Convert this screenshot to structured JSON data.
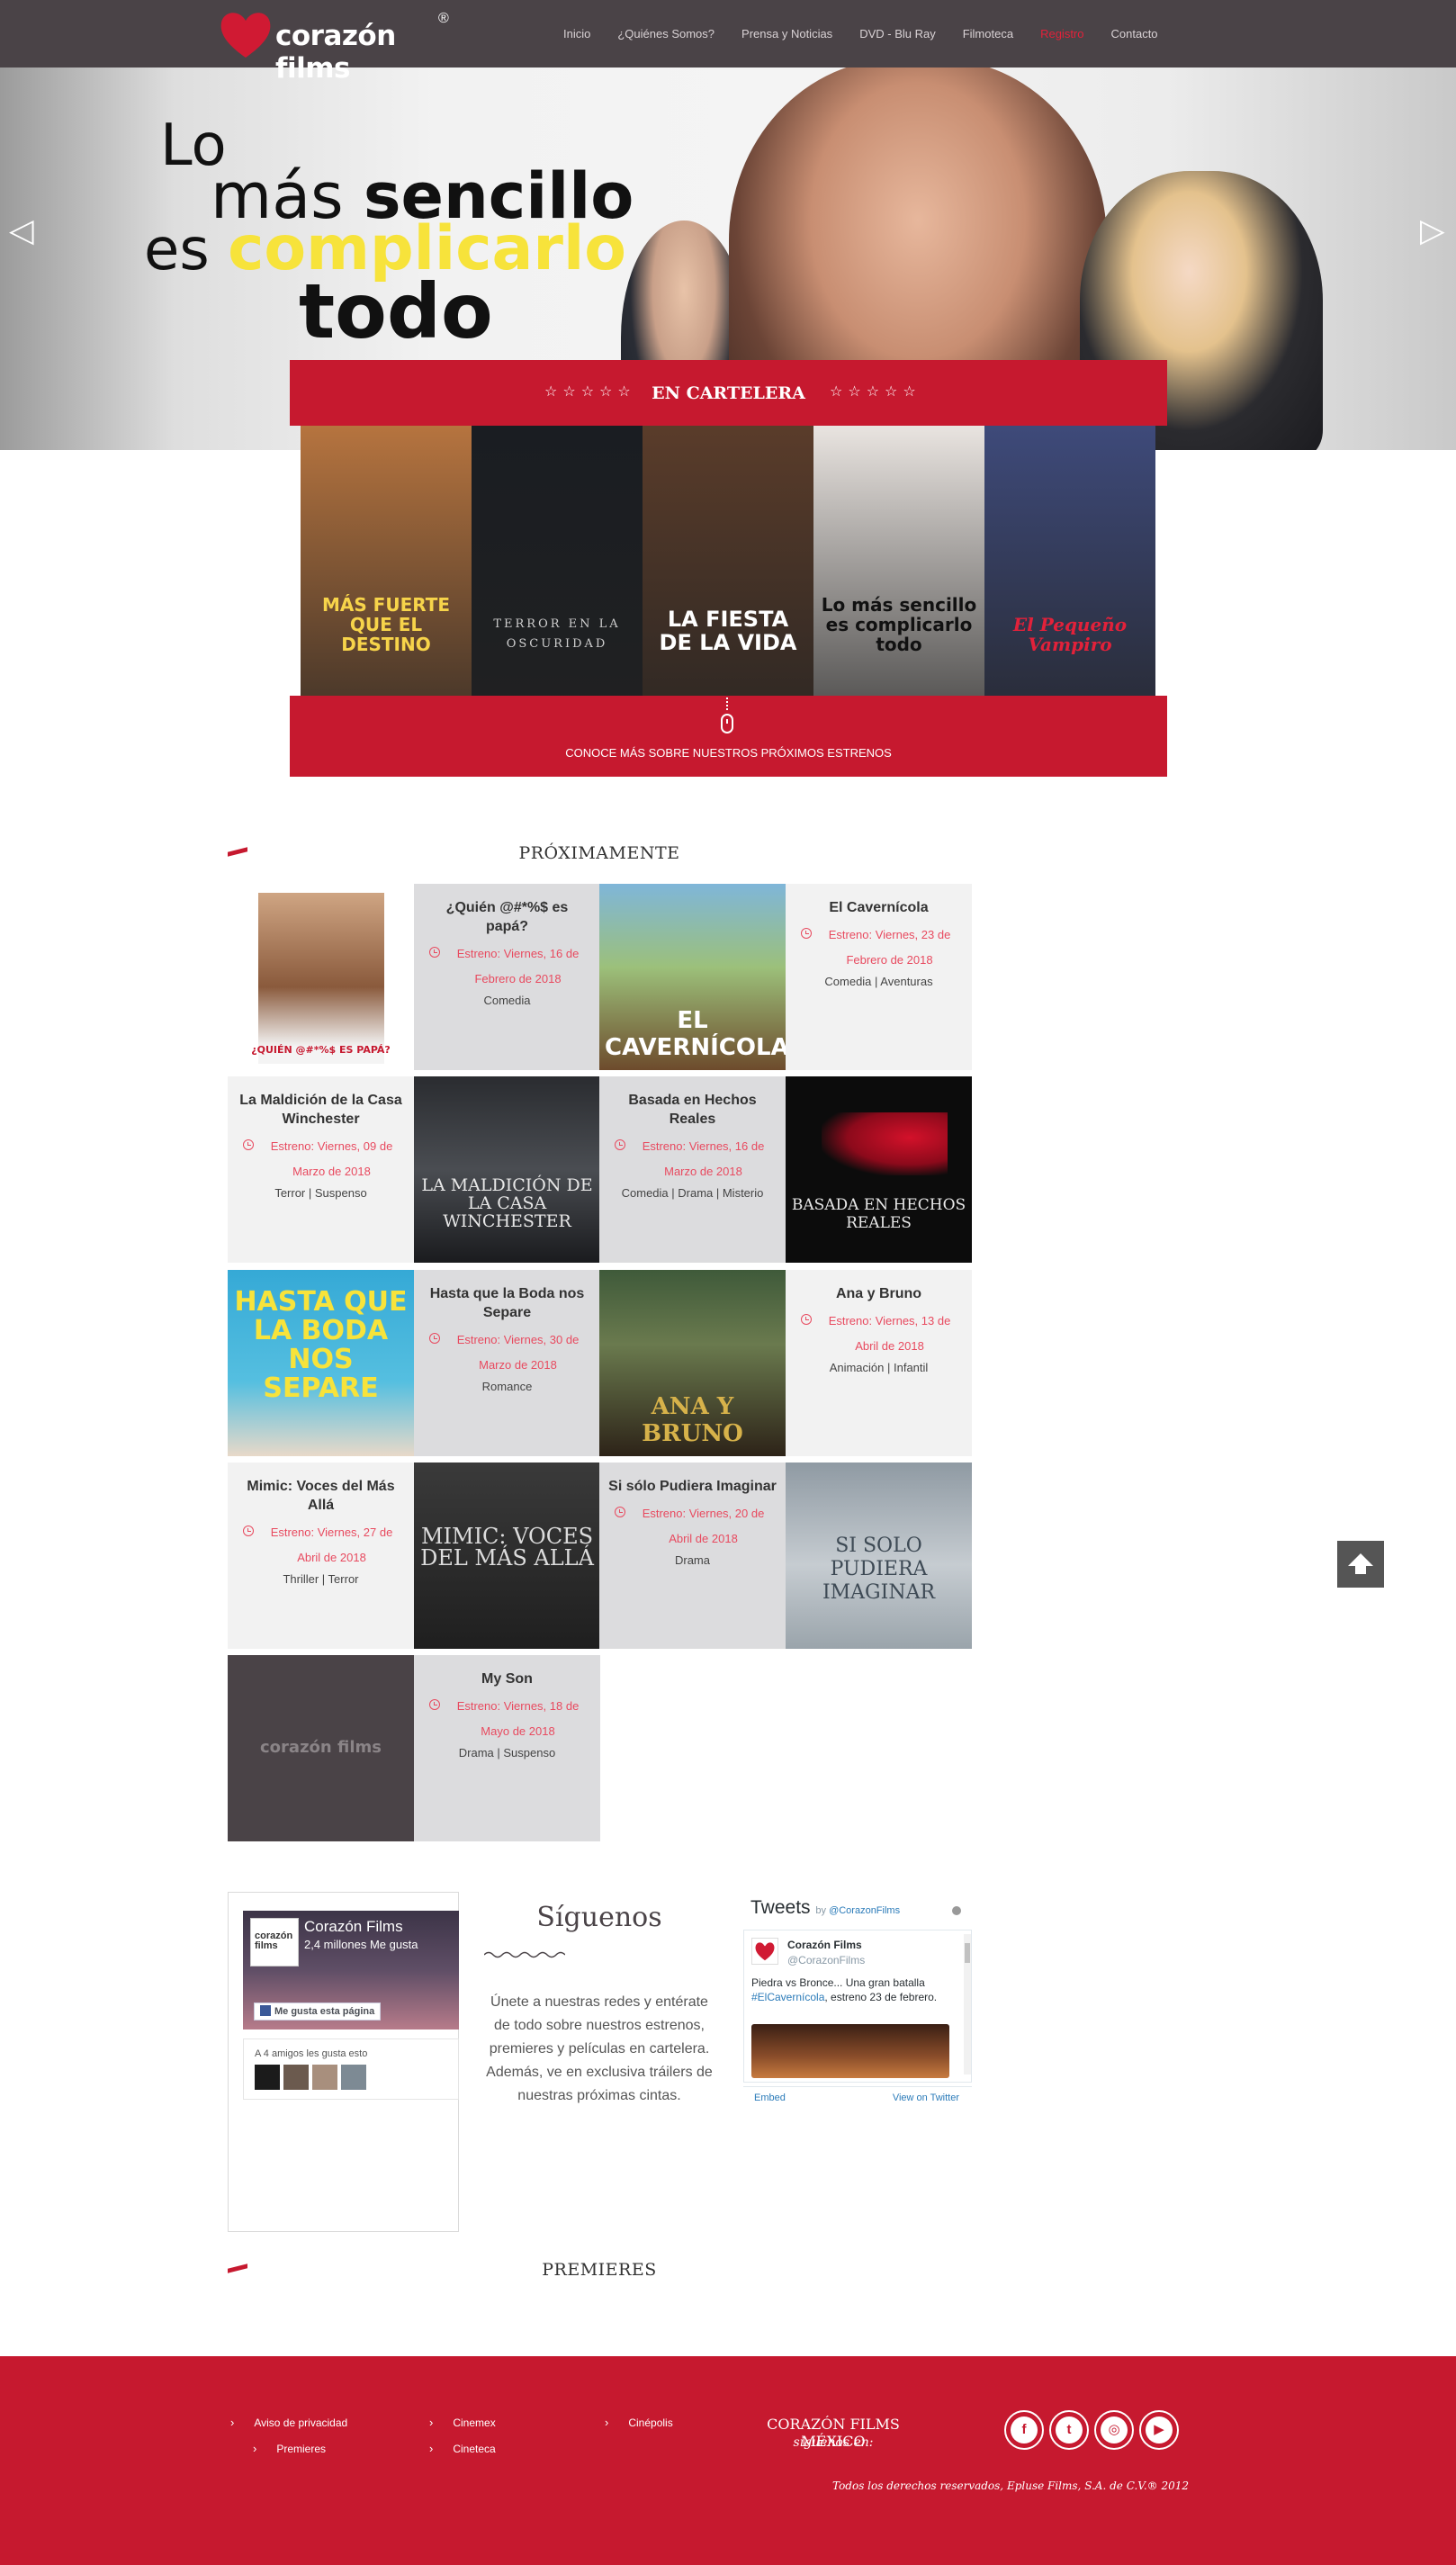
{
  "brand": {
    "name": "corazón films",
    "reg": "®"
  },
  "nav": {
    "items": [
      {
        "label": "Inicio",
        "active": false
      },
      {
        "label": "¿Quiénes Somos?",
        "active": false
      },
      {
        "label": "Prensa y Noticias",
        "active": false
      },
      {
        "label": "DVD - Blu Ray",
        "active": false
      },
      {
        "label": "Filmoteca",
        "active": false
      },
      {
        "label": "Registro",
        "active": true
      },
      {
        "label": "Contacto",
        "active": false
      }
    ]
  },
  "hero": {
    "line1": "Lo",
    "line2_a": "más ",
    "line2_b": "sencillo",
    "line3_a": "es ",
    "line3_b": "complicarlo",
    "line4": "todo",
    "prev_icon": "triangle-left-icon",
    "next_icon": "triangle-right-icon"
  },
  "cartelera": {
    "title": "EN CARTELERA",
    "stars": "☆☆☆☆☆",
    "posters": [
      {
        "title": "MÁS FUERTE QUE EL DESTINO",
        "bg": "#b6743f",
        "color": "#f7d44a"
      },
      {
        "title": "TERROR EN LA OSCURIDAD",
        "bg": "#1a1d22",
        "color": "#cfcfcf"
      },
      {
        "title": "LA FIESTA DE LA VIDA",
        "bg": "#5a3c2a",
        "color": "#ffffff"
      },
      {
        "title": "Lo más sencillo es complicarlo todo",
        "bg": "#e9e4e0",
        "color": "#111111"
      },
      {
        "title": "El Pequeño Vampiro",
        "bg": "#3e4a7a",
        "color": "#e2213a"
      }
    ],
    "more_label": "CONOCE MÁS SOBRE NUESTROS PRÓXIMOS ESTRENOS"
  },
  "proximamente": {
    "title": "PRÓXIMAMENTE",
    "movies": [
      {
        "title": "¿Quién @#*%$ es papá?",
        "release": "Estreno: Viernes, 16 de Febrero de 2018",
        "genre": "Comedia",
        "poster_text": "¿QUIÉN @#*%$ ES PAPÁ?"
      },
      {
        "title": "El Cavernícola",
        "release": "Estreno: Viernes, 23 de Febrero de 2018",
        "genre": "Comedia | Aventuras",
        "poster_text": "EL CAVERNÍCOLA"
      },
      {
        "title": "La Maldición de la Casa Winchester",
        "release": "Estreno: Viernes, 09 de Marzo de 2018",
        "genre": "Terror | Suspenso",
        "poster_text": "LA MALDICIÓN DE LA CASA WINCHESTER"
      },
      {
        "title": "Basada en Hechos Reales",
        "release": "Estreno: Viernes, 16 de Marzo de 2018",
        "genre": "Comedia | Drama | Misterio",
        "poster_text": "BASADA EN HECHOS REALES"
      },
      {
        "title": "Hasta que la Boda nos Separe",
        "release": "Estreno: Viernes, 30 de Marzo de 2018",
        "genre": "Romance",
        "poster_text": "HASTA QUE LA BODA NOS SEPARE"
      },
      {
        "title": "Ana y Bruno",
        "release": "Estreno: Viernes, 13 de Abril de 2018",
        "genre": "Animación | Infantil",
        "poster_text": "ANA Y BRUNO"
      },
      {
        "title": "Mimic: Voces del Más Allá",
        "release": "Estreno: Viernes, 27 de Abril de 2018",
        "genre": "Thriller | Terror",
        "poster_text": "MIMIC: VOCES DEL MÁS ALLÁ"
      },
      {
        "title": "Si sólo Pudiera Imaginar",
        "release": "Estreno: Viernes, 20 de Abril de 2018",
        "genre": "Drama",
        "poster_text": "SI SOLO PUDIERA IMAGINAR"
      },
      {
        "title": "My Son",
        "release": "Estreno: Viernes, 18 de Mayo de 2018",
        "genre": "Drama | Suspenso",
        "poster_text": "corazón films"
      }
    ]
  },
  "siguenos": {
    "title": "Síguenos",
    "text": "Únete a nuestras redes y entérate de todo sobre nuestros estrenos, premieres y películas en cartelera. Además, ve en exclusiva tráilers de nuestras próximas cintas."
  },
  "facebook": {
    "page_name": "Corazón Films",
    "likes": "2,4 millones Me gusta",
    "like_button": "Me gusta esta página",
    "friends": "A 4 amigos les gusta esto",
    "logo_text": "corazón films"
  },
  "twitter": {
    "title": "Tweets",
    "by": "by ",
    "handle_link": "@CorazonFilms",
    "user": "Corazón Films",
    "handle": "@CorazonFilms",
    "text_a": "Piedra vs Bronce... Una gran batalla ",
    "hashtag": "#ElCavernícola",
    "text_b": ", estreno 23 de febrero.",
    "embed": "Embed",
    "view": "View on Twitter"
  },
  "premieres": {
    "title": "PREMIERES"
  },
  "footer": {
    "links": {
      "privacy": "Aviso de privacidad",
      "premieres": "Premieres",
      "cinemex": "Cinemex",
      "cineteca": "Cineteca",
      "cinepolis": "Cinépolis"
    },
    "brand": "CORAZÓN FILMS MÉXICO",
    "follow": "síguenos en:",
    "social": [
      "facebook-icon",
      "twitter-icon",
      "instagram-icon",
      "youtube-icon"
    ],
    "copyright": "Todos los derechos reservados, Epluse Films, S.A. de C.V.® 2012"
  },
  "colors": {
    "accent": "#c6192f",
    "nav_bg": "#4a4347",
    "release_text": "#e84a5f"
  }
}
